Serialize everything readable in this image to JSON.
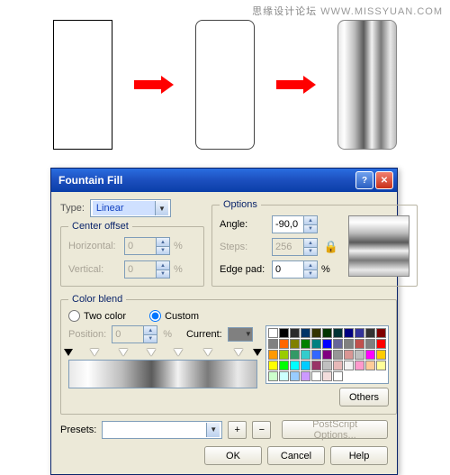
{
  "watermark": {
    "cn": "思缘设计论坛",
    "url": "WWW.MISSYUAN.COM"
  },
  "dialog": {
    "title": "Fountain Fill",
    "type_label": "Type:",
    "type_value": "Linear",
    "groups": {
      "center_offset": "Center offset",
      "options": "Options",
      "color_blend": "Color blend"
    },
    "center_offset": {
      "horizontal_label": "Horizontal:",
      "horizontal_value": "0",
      "horizontal_unit": "%",
      "vertical_label": "Vertical:",
      "vertical_value": "0",
      "vertical_unit": "%"
    },
    "options": {
      "angle_label": "Angle:",
      "angle_value": "-90,0",
      "steps_label": "Steps:",
      "steps_value": "256",
      "edgepad_label": "Edge pad:",
      "edgepad_value": "0",
      "edgepad_unit": "%"
    },
    "color_blend": {
      "two_color": "Two color",
      "custom": "Custom",
      "position_label": "Position:",
      "position_value": "0",
      "position_unit": "%",
      "current_label": "Current:"
    },
    "palette_colors": [
      "#ffffff",
      "#000000",
      "#2b2b2b",
      "#003366",
      "#333300",
      "#003300",
      "#003333",
      "#000080",
      "#333399",
      "#333333",
      "#800000",
      "#808080",
      "#ff6600",
      "#808000",
      "#008000",
      "#008080",
      "#0000ff",
      "#666699",
      "#808080",
      "#c0504d",
      "#7f7f7f",
      "#ff0000",
      "#ff9900",
      "#99cc00",
      "#339966",
      "#33cccc",
      "#3366ff",
      "#800080",
      "#969696",
      "#d99694",
      "#bfbfbf",
      "#ff00ff",
      "#ffcc00",
      "#ffff00",
      "#00ff00",
      "#00ffff",
      "#00ccff",
      "#993366",
      "#c0c0c0",
      "#e6b9b8",
      "#f2f2f2",
      "#ff99cc",
      "#ffcc99",
      "#ffff99",
      "#ccffcc",
      "#ccffff",
      "#99ccff",
      "#cc99ff",
      "#ffffff",
      "#f2dddc",
      "#ffffff"
    ],
    "others_btn": "Others",
    "presets_label": "Presets:",
    "postscript_btn": "PostScript Options...",
    "ok": "OK",
    "cancel": "Cancel",
    "help": "Help",
    "plus": "+",
    "minus": "−"
  }
}
